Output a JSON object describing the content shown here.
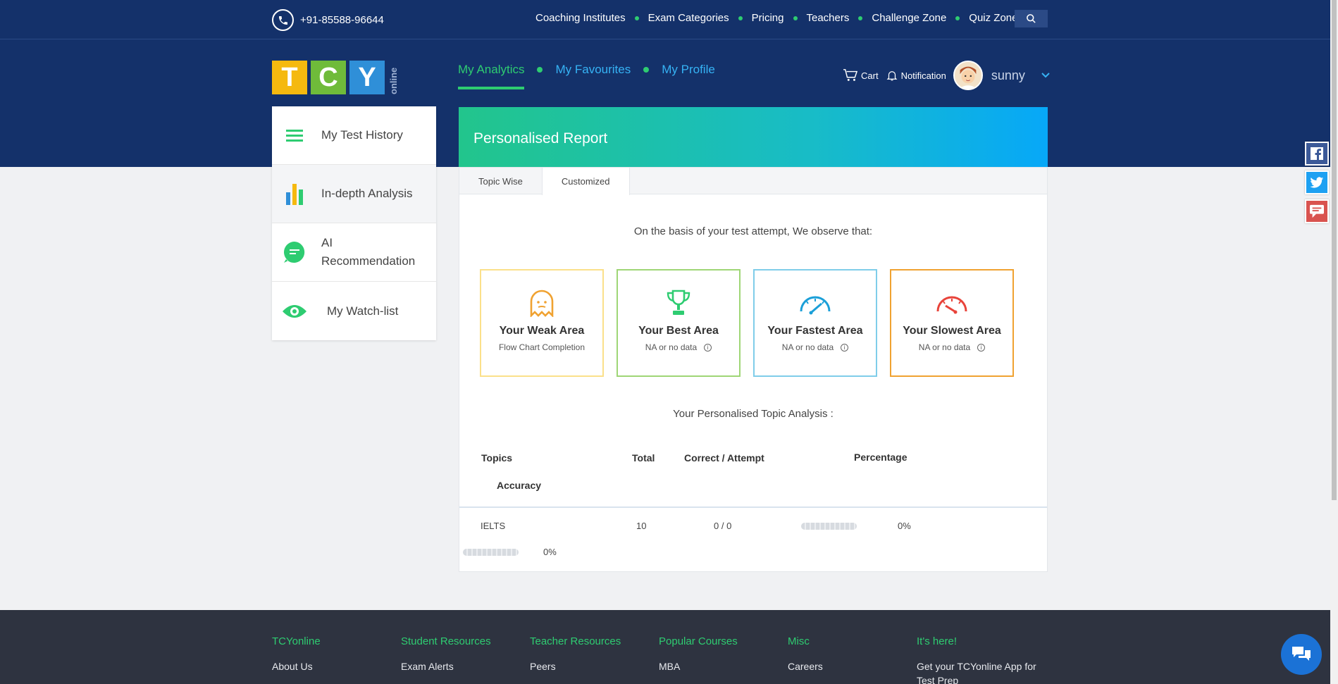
{
  "topbar": {
    "phone": "+91-85588-96644",
    "nav": [
      "Coaching Institutes",
      "Exam Categories",
      "Pricing",
      "Teachers",
      "Challenge Zone",
      "Quiz Zone"
    ]
  },
  "logo": {
    "letters": [
      "T",
      "C",
      "Y"
    ],
    "suffix": "online"
  },
  "subnav": [
    "My Analytics",
    "My Favourites",
    "My Profile"
  ],
  "user": {
    "cart": "Cart",
    "notification": "Notification",
    "name": "sunny"
  },
  "sidebar": {
    "items": [
      {
        "label": "My Test History",
        "icon": "menu-icon"
      },
      {
        "label": "In-depth Analysis",
        "icon": "bar-chart-icon"
      },
      {
        "label": "AI Recommendation",
        "icon": "chat-bubble-icon"
      },
      {
        "label": "My Watch-list",
        "icon": "eye-icon"
      }
    ]
  },
  "report": {
    "title": "Personalised Report",
    "tabs": [
      "Topic Wise",
      "Customized"
    ],
    "observe": "On the basis of your test attempt, We observe that:",
    "cards": [
      {
        "title": "Your Weak Area",
        "sub": "Flow Chart Completion",
        "icon": "ghost-icon",
        "color": "#fbe08a"
      },
      {
        "title": "Your Best Area",
        "sub": "NA or no data",
        "icon": "trophy-icon",
        "color": "#9fd676"
      },
      {
        "title": "Your Fastest Area",
        "sub": "NA or no data",
        "icon": "speedometer-fast-icon",
        "color": "#7fcde9"
      },
      {
        "title": "Your Slowest Area",
        "sub": "NA or no data",
        "icon": "speedometer-slow-icon",
        "color": "#f0a231"
      }
    ],
    "analysis_title": "Your Personalised Topic Analysis :",
    "columns": [
      "Topics",
      "Total",
      "Correct / Attempt",
      "Percentage",
      "Accuracy"
    ],
    "rows": [
      {
        "topic": "IELTS",
        "total": "10",
        "correct_attempt": "0 / 0",
        "percentage": "0%",
        "accuracy": "0%"
      }
    ]
  },
  "footer": {
    "columns": [
      {
        "heading": "TCYonline",
        "link": "About Us"
      },
      {
        "heading": "Student Resources",
        "link": "Exam Alerts"
      },
      {
        "heading": "Teacher Resources",
        "link": "Peers"
      },
      {
        "heading": "Popular Courses",
        "link": "MBA"
      },
      {
        "heading": "Misc",
        "link": "Careers"
      },
      {
        "heading": "It's here!",
        "link": "Get your TCYonline App for Test Prep"
      }
    ]
  },
  "colors": {
    "navy": "#14316a",
    "green": "#2ecc71",
    "blue": "#36b3f5"
  }
}
